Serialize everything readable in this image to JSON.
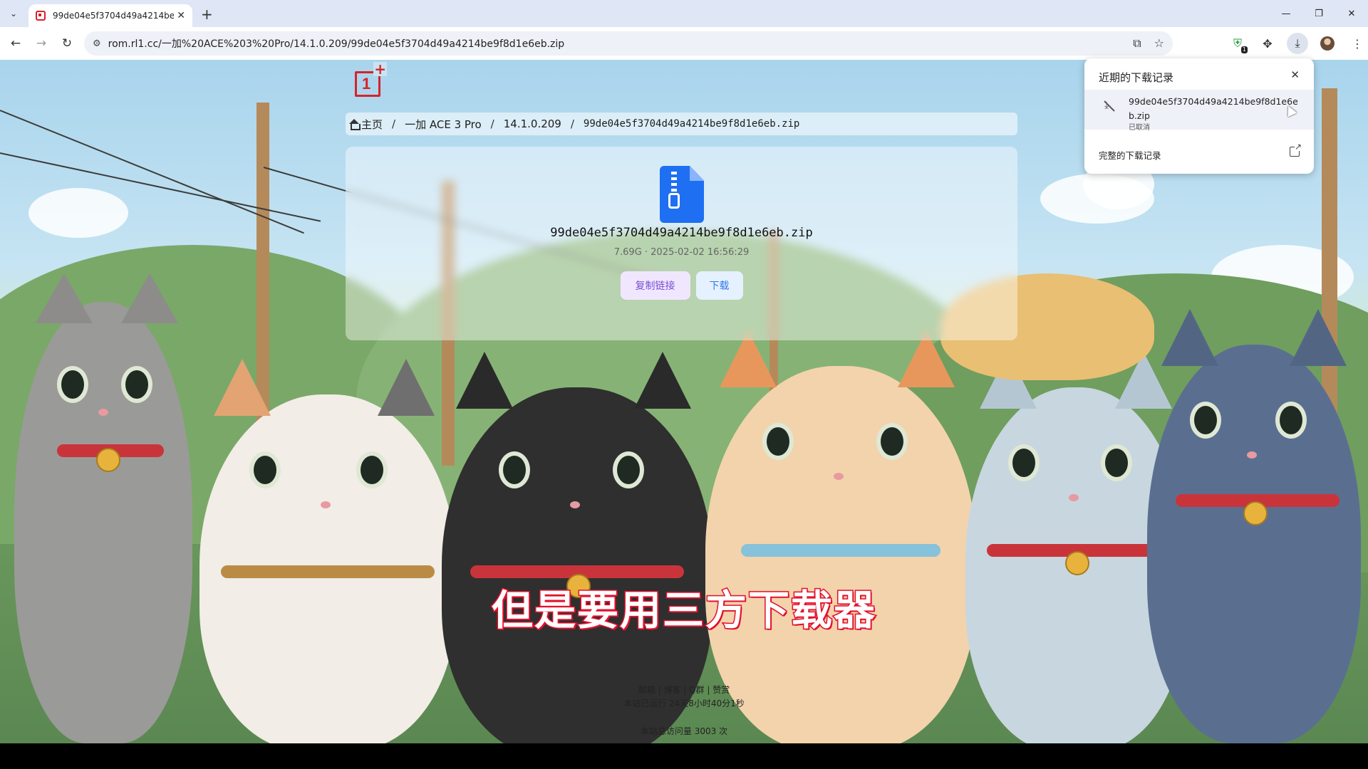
{
  "browser": {
    "tab": {
      "title": "99de04e5f3704d49a4214be9f8d1e6eb.zip",
      "brand_color": "#d6232a"
    },
    "url": "rom.rl1.cc/一加%20ACE%203%20Pro/14.1.0.209/99de04e5f3704d49a4214be9f8d1e6eb.zip",
    "icons": {
      "tab_search": "chevron-down-icon",
      "back": "arrow-left-icon",
      "forward": "arrow-right-icon",
      "reload": "reload-icon",
      "site_info": "tune-icon",
      "install": "install-app-icon",
      "bookmark": "star-icon",
      "extension_badge": "1",
      "extensions": "puzzle-icon",
      "downloads": "download-icon",
      "menu": "more-vert-icon"
    }
  },
  "downloads_popup": {
    "title": "近期的下载记录",
    "item": {
      "filename": "99de04e5f3704d49a4214be9f8d1e6eb.zip",
      "status": "已取消"
    },
    "full_history": "完整的下载记录"
  },
  "page": {
    "breadcrumb": [
      {
        "label": "主页"
      },
      {
        "label": "一加 ACE 3 Pro"
      },
      {
        "label": "14.1.0.209"
      },
      {
        "label": "99de04e5f3704d49a4214be9f8d1e6eb.zip"
      }
    ],
    "separator": "/",
    "file": {
      "name": "99de04e5f3704d49a4214be9f8d1e6eb.zip",
      "meta": "7.69G · 2025-02-02 16:56:29",
      "icon": "zip-file-icon",
      "icon_color": "#1e6ff2"
    },
    "buttons": {
      "copy_link": "复制链接",
      "download": "下载"
    },
    "footer": {
      "links": "邮箱 | 博客 | Q群 | 赞赏",
      "uptime": "本站已运行 24天8小时40分1秒",
      "visits": "本站总访问量 3003 次"
    }
  },
  "subtitle": "但是要用三方下载器"
}
